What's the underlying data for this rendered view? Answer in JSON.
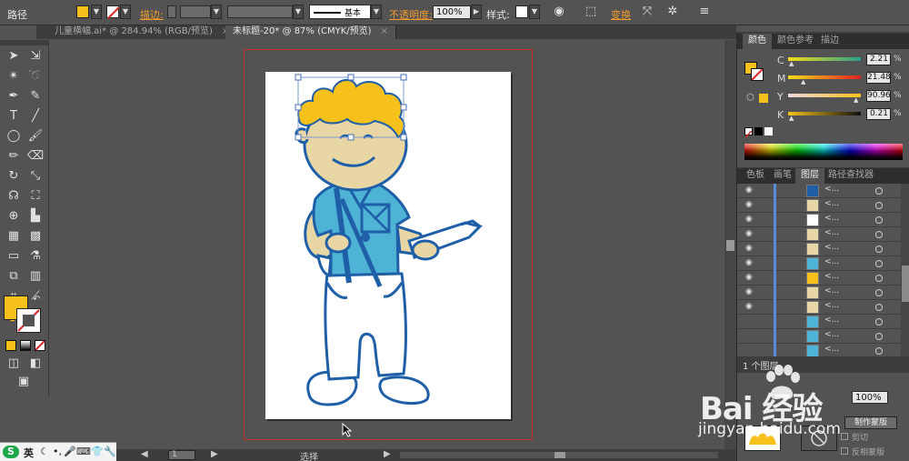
{
  "control_bar": {
    "object_type": "路径",
    "fill_color": "#f5c11a",
    "stroke_label": "描边:",
    "stroke_profile": "基本",
    "opacity_label": "不透明度:",
    "opacity_value": "100%",
    "style_label": "样式:",
    "transform_label": "变换"
  },
  "tabs": [
    {
      "label": "儿童横幅.ai* @ 284.94% (RGB/预览)",
      "close": "×"
    },
    {
      "label": "未标题-20* @ 87% (CMYK/预览)",
      "close": "×"
    }
  ],
  "toolbar": {
    "fill_color": "#f5c11a",
    "stroke_color": "#ffffff"
  },
  "color_panel": {
    "tabs": [
      "颜色",
      "颜色参考",
      "描边"
    ],
    "channels": [
      {
        "label": "C",
        "value": "2.21",
        "unit": "%"
      },
      {
        "label": "M",
        "value": "21.48",
        "unit": "%"
      },
      {
        "label": "Y",
        "value": "90.96",
        "unit": "%"
      },
      {
        "label": "K",
        "value": "0.21",
        "unit": "%"
      }
    ],
    "fill_color": "#f5c11a"
  },
  "layers_panel": {
    "tabs": [
      "色板",
      "画笔",
      "图层",
      "路径查找器"
    ],
    "row_name": "<...",
    "footer_count": "1 个图层",
    "thumb_colors": [
      "#1e5fa8",
      "#e8d6a5",
      "#ffffff",
      "#e8d6a5",
      "#e8d6a5",
      "#4fb3d6",
      "#f5c11a",
      "#e8d6a5",
      "#e8d6a5",
      "#4fb3d6",
      "#4fb3d6",
      "#4fb3d6"
    ]
  },
  "bottom_panel": {
    "opacity_value": "100%",
    "make_mask_button": "制作蒙版",
    "clip_label": "剪切",
    "invert_mask_label": "反相蒙版"
  },
  "status_bar": {
    "zoom": "87%",
    "page": "1",
    "tool": "选择"
  },
  "tray": {
    "ime": "英",
    "icons": [
      "moon-icon",
      "comma-icon",
      "mic-icon",
      "keyboard-icon",
      "shirt-icon",
      "wrench-icon"
    ]
  },
  "watermark": {
    "brand": "Bai 经验",
    "url": "jingyan.baidu.com"
  }
}
